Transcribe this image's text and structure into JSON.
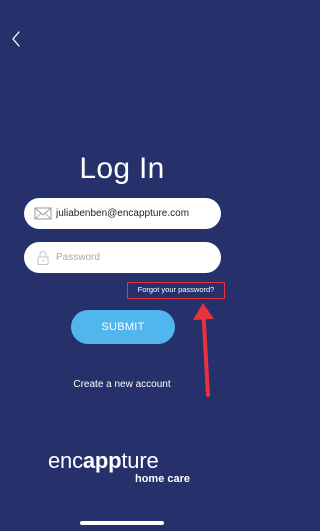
{
  "header": {
    "back_icon": "chevron-left-icon"
  },
  "login": {
    "title": "Log In",
    "email": {
      "value": "juliabenben@encappture.com",
      "icon": "envelope-icon"
    },
    "password": {
      "value": "",
      "placeholder": "Password",
      "icon": "lock-icon"
    },
    "forgot_label": "Forgot your password?",
    "submit_label": "SUBMIT",
    "create_account_label": "Create a new account"
  },
  "logo": {
    "brand_prefix": "enc",
    "brand_bold": "app",
    "brand_suffix": "ture",
    "sub": "home care"
  },
  "colors": {
    "background": "#26306b",
    "submit_button": "#52b6ee",
    "highlight_annotation": "#e8323c"
  }
}
